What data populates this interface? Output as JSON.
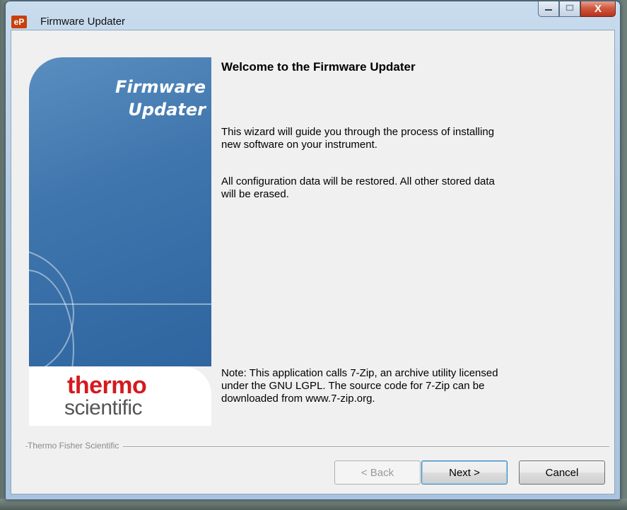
{
  "window": {
    "title": "Firmware Updater",
    "icon_text": "eP",
    "controls": {
      "minimize": "minimize-icon",
      "maximize": "maximize-icon",
      "close": "X"
    }
  },
  "banner": {
    "title_line1": "Firmware",
    "title_line2": "Updater",
    "logo_line1": "thermo",
    "logo_line2": "scientific"
  },
  "content": {
    "heading": "Welcome to the Firmware Updater",
    "paragraph1_line1": "This wizard will guide you through the process of installing",
    "paragraph1_line2": "new software on your instrument.",
    "paragraph2_line1": "All configuration data will be restored.  All other stored data",
    "paragraph2_line2": "will be erased.",
    "note_line1": "Note: This application calls 7-Zip, an archive utility licensed",
    "note_line2": "under the GNU LGPL.  The source code for 7-Zip can be",
    "note_line3": "downloaded from www.7-zip.org."
  },
  "footer": {
    "group_label": "Thermo Fisher Scientific",
    "back_label": "< Back",
    "next_label": "Next >",
    "cancel_label": "Cancel"
  },
  "colors": {
    "banner_blue": "#3f76ad",
    "logo_red": "#d41a1f",
    "close_red": "#c8452c"
  }
}
